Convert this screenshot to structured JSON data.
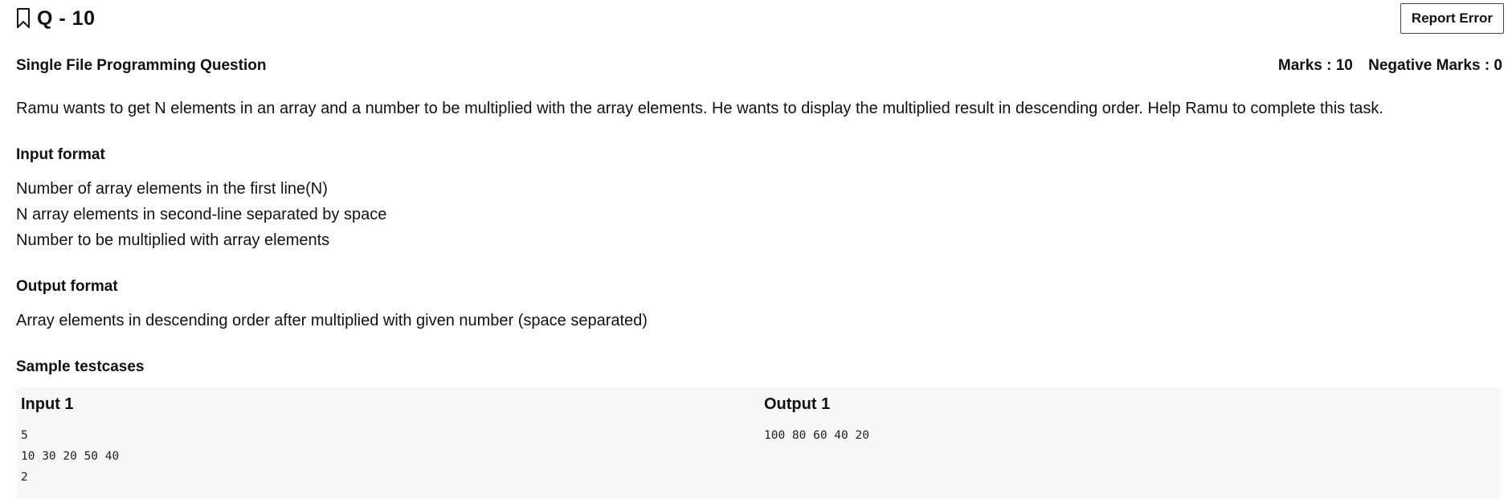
{
  "question": {
    "title": "Q - 10",
    "report_label": "Report Error",
    "type": "Single File Programming Question",
    "marks": "Marks : 10",
    "negative_marks": "Negative Marks : 0"
  },
  "problem": "Ramu wants to get N elements in an array and a number to be multiplied with the array elements. He wants to display the multiplied result in descending order. Help Ramu to complete this task.",
  "input_format": {
    "title": "Input format",
    "lines": [
      "Number of array elements in the first line(N)",
      "N array elements in second-line separated by space",
      "Number to be multiplied with array elements"
    ]
  },
  "output_format": {
    "title": "Output format",
    "lines": [
      "Array elements in descending order after multiplied with given number (space separated)"
    ]
  },
  "sample": {
    "title": "Sample testcases",
    "input_label": "Input 1",
    "output_label": "Output 1",
    "input_lines": [
      "5",
      "10 30 20 50 40",
      "2"
    ],
    "output_lines": [
      "100 80 60 40 20"
    ]
  },
  "icons": {
    "bookmark": "bookmark-icon"
  }
}
